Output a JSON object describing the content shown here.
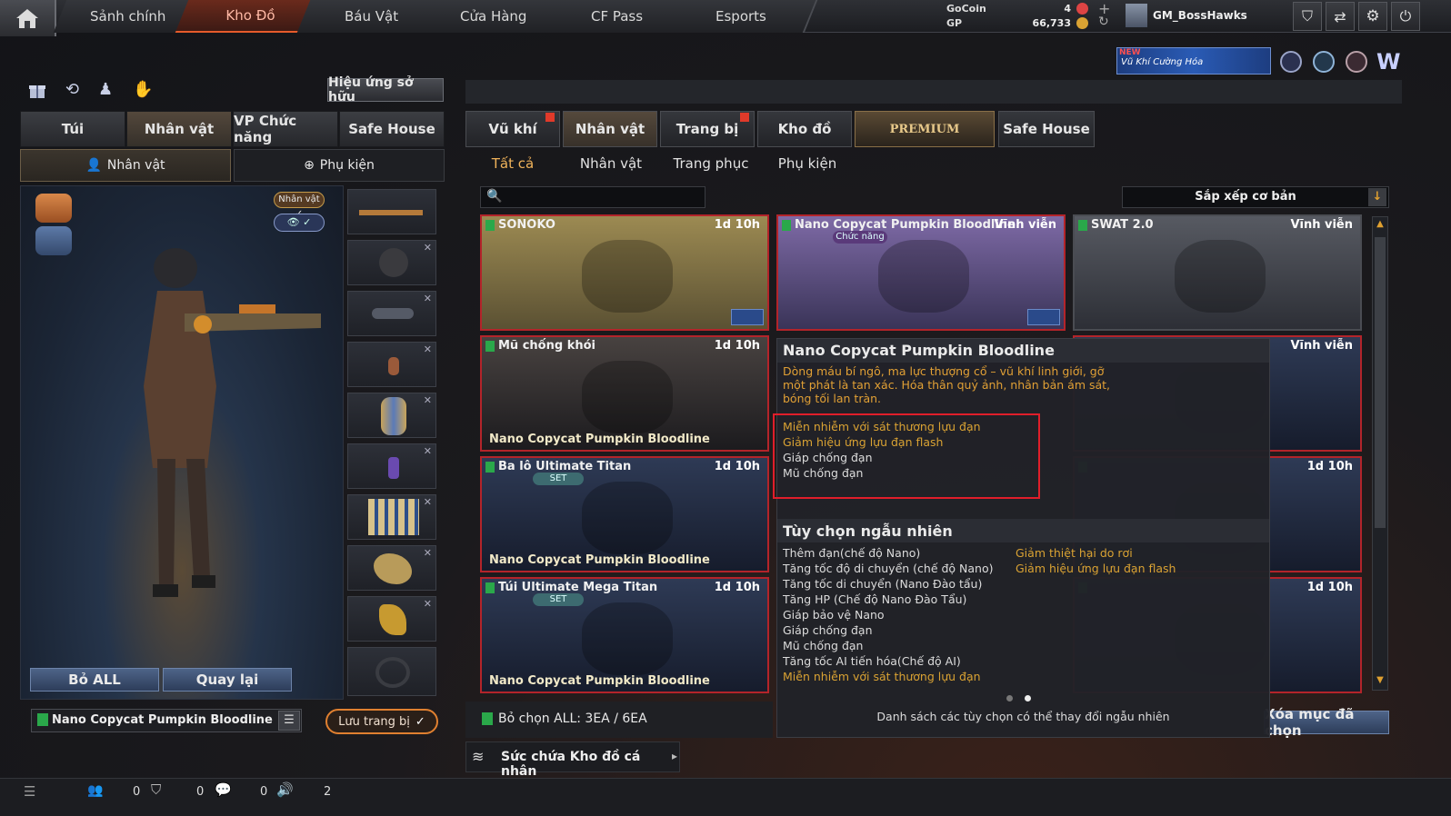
{
  "nav": {
    "home": "home",
    "tabs": [
      "Sảnh chính",
      "Kho Đồ",
      "Báu Vật",
      "Cửa Hàng",
      "CF Pass",
      "Esports"
    ],
    "active_tab": 1
  },
  "currency": {
    "gocoin_label": "GoCoin",
    "gp_label": "GP",
    "gocoin_value": "4",
    "gp_value": "66,733"
  },
  "user": {
    "name": "GM_BossHawks"
  },
  "promo": {
    "badge": "NEW",
    "text": "Vũ Khí Cường Hóa"
  },
  "left": {
    "effects_button": "Hiệu ứng sở hữu",
    "tabs": [
      "Túi",
      "Nhân vật",
      "VP Chức năng",
      "Safe House"
    ],
    "subtabs": [
      "Nhân vật",
      "Phụ kiện"
    ],
    "badge_character": "Nhân vật ✓",
    "btn_remove_all": "Bỏ ALL",
    "btn_back": "Quay lại",
    "character_name": "Nano Copycat Pumpkin Bloodline",
    "save_button": "Lưu trang bị"
  },
  "right": {
    "tabs": [
      "Vũ khí",
      "Nhân vật",
      "Trang bị",
      "Kho đồ",
      "PREMIUM",
      "Safe House"
    ],
    "filters": [
      "Tất cả",
      "Nhân vật",
      "Trang phục",
      "Phụ kiện"
    ],
    "search_placeholder": "",
    "sort_label": "Sắp xếp cơ bản",
    "deselect_status": "Bỏ chọn ALL: 3EA / 6EA",
    "delete_button": "Xóa mục đã chọn",
    "storage_label": "Sức chứa Kho đồ cá nhân"
  },
  "cards": [
    {
      "name": "SONOKO",
      "time": "1d 10h",
      "owner": ""
    },
    {
      "name": "Nano Copycat Pumpkin Bloodline",
      "time": "Vĩnh viễn",
      "owner": "",
      "tag": "Chức năng"
    },
    {
      "name": "SWAT 2.0",
      "time": "Vĩnh viễn",
      "owner": ""
    },
    {
      "name": "Mũ chống khói",
      "time": "1d 10h",
      "owner": "Nano Copycat Pumpkin Bloodline"
    },
    {
      "name": "",
      "time": "Vĩnh viễn",
      "owner": ""
    },
    {
      "name": "Ba lô Ultimate Titan",
      "time": "1d 10h",
      "owner": "Nano Copycat Pumpkin Bloodline",
      "set": "SET"
    },
    {
      "name": "",
      "time": "1d 10h",
      "owner": ""
    },
    {
      "name": "Túi Ultimate Mega Titan",
      "time": "1d 10h",
      "owner": "Nano Copycat Pumpkin Bloodline",
      "set": "SET"
    },
    {
      "name": "",
      "time": "1d 10h",
      "owner": ""
    }
  ],
  "tooltip": {
    "title": "Nano Copycat Pumpkin Bloodline",
    "description": "Dòng máu bí ngô, ma lực thượng cổ – vũ khí linh giới, gỡ một phát là tan xác. Hóa thân quỷ ảnh, nhân bản ám sát, bóng tối lan tràn.",
    "features": [
      {
        "text": "Miễn nhiễm với sát thương lựu đạn",
        "style": "gold"
      },
      {
        "text": "Giảm hiệu ứng lựu đạn flash",
        "style": "gold"
      },
      {
        "text": "Giáp chống đạn",
        "style": "white"
      },
      {
        "text": "Mũ chống đạn",
        "style": "white"
      }
    ],
    "random_title": "Tùy chọn ngẫu nhiên",
    "random_left": [
      {
        "text": "Thêm đạn(chế độ Nano)",
        "style": "white"
      },
      {
        "text": "Tăng tốc độ di chuyển (chế độ Nano)",
        "style": "white"
      },
      {
        "text": "Tăng tốc di chuyển (Nano Đào tẩu)",
        "style": "white"
      },
      {
        "text": "Tăng HP (Chế độ Nano Đào Tẩu)",
        "style": "white"
      },
      {
        "text": "Giáp bảo vệ Nano",
        "style": "white"
      },
      {
        "text": "Giáp chống đạn",
        "style": "white"
      },
      {
        "text": "Mũ chống đạn",
        "style": "white"
      },
      {
        "text": "Tăng tốc AI tiến hóa(Chế độ AI)",
        "style": "white"
      },
      {
        "text": "Miễn nhiễm với sát thương lựu đạn",
        "style": "gold"
      }
    ],
    "random_right": [
      {
        "text": "Giảm thiệt hại do rơi",
        "style": "gold"
      },
      {
        "text": "Giảm hiệu ứng lựu đạn flash",
        "style": "gold"
      }
    ],
    "footer": "Danh sách các tùy chọn có thể thay đổi ngẫu nhiên"
  },
  "statusbar": {
    "counts": [
      "0",
      "0",
      "0",
      "2"
    ]
  },
  "colors": {
    "accent_red": "#b3242a",
    "gold_text": "#d9a233",
    "highlight_box": "#e01e2a"
  }
}
